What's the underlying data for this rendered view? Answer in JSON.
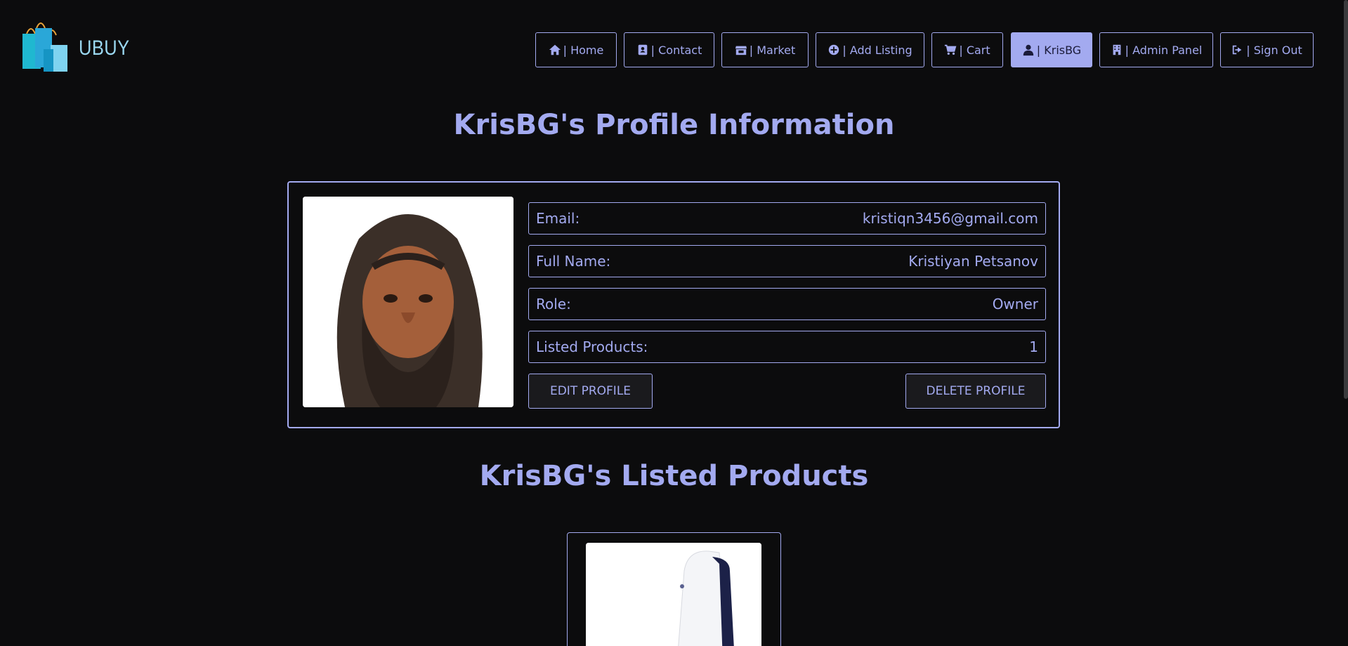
{
  "brand": {
    "name": "UBUY"
  },
  "nav": [
    {
      "icon": "home-icon",
      "label": "| Home"
    },
    {
      "icon": "contact-card-icon",
      "label": "| Contact"
    },
    {
      "icon": "store-icon",
      "label": "| Market"
    },
    {
      "icon": "plus-circle-icon",
      "label": "| Add Listing"
    },
    {
      "icon": "cart-icon",
      "label": "| Cart"
    },
    {
      "icon": "user-icon",
      "label": "| KrisBG",
      "active": true
    },
    {
      "icon": "building-icon",
      "label": "| Admin Panel"
    },
    {
      "icon": "sign-out-icon",
      "label": "| Sign Out"
    }
  ],
  "profile": {
    "heading": "KrisBG's Profile Information",
    "fields": [
      {
        "label": "Email:",
        "value": "kristiqn3456@gmail.com"
      },
      {
        "label": "Full Name:",
        "value": "Kristiyan Petsanov"
      },
      {
        "label": "Role:",
        "value": "Owner"
      },
      {
        "label": "Listed Products:",
        "value": "1"
      }
    ],
    "edit_label": "Edit Profile",
    "delete_label": "Delete Profile"
  },
  "products": {
    "heading": "KrisBG's Listed Products"
  },
  "colors": {
    "accent": "#a3aaf0",
    "background": "#0c0c0d",
    "logo_text": "#9ad7f0"
  }
}
